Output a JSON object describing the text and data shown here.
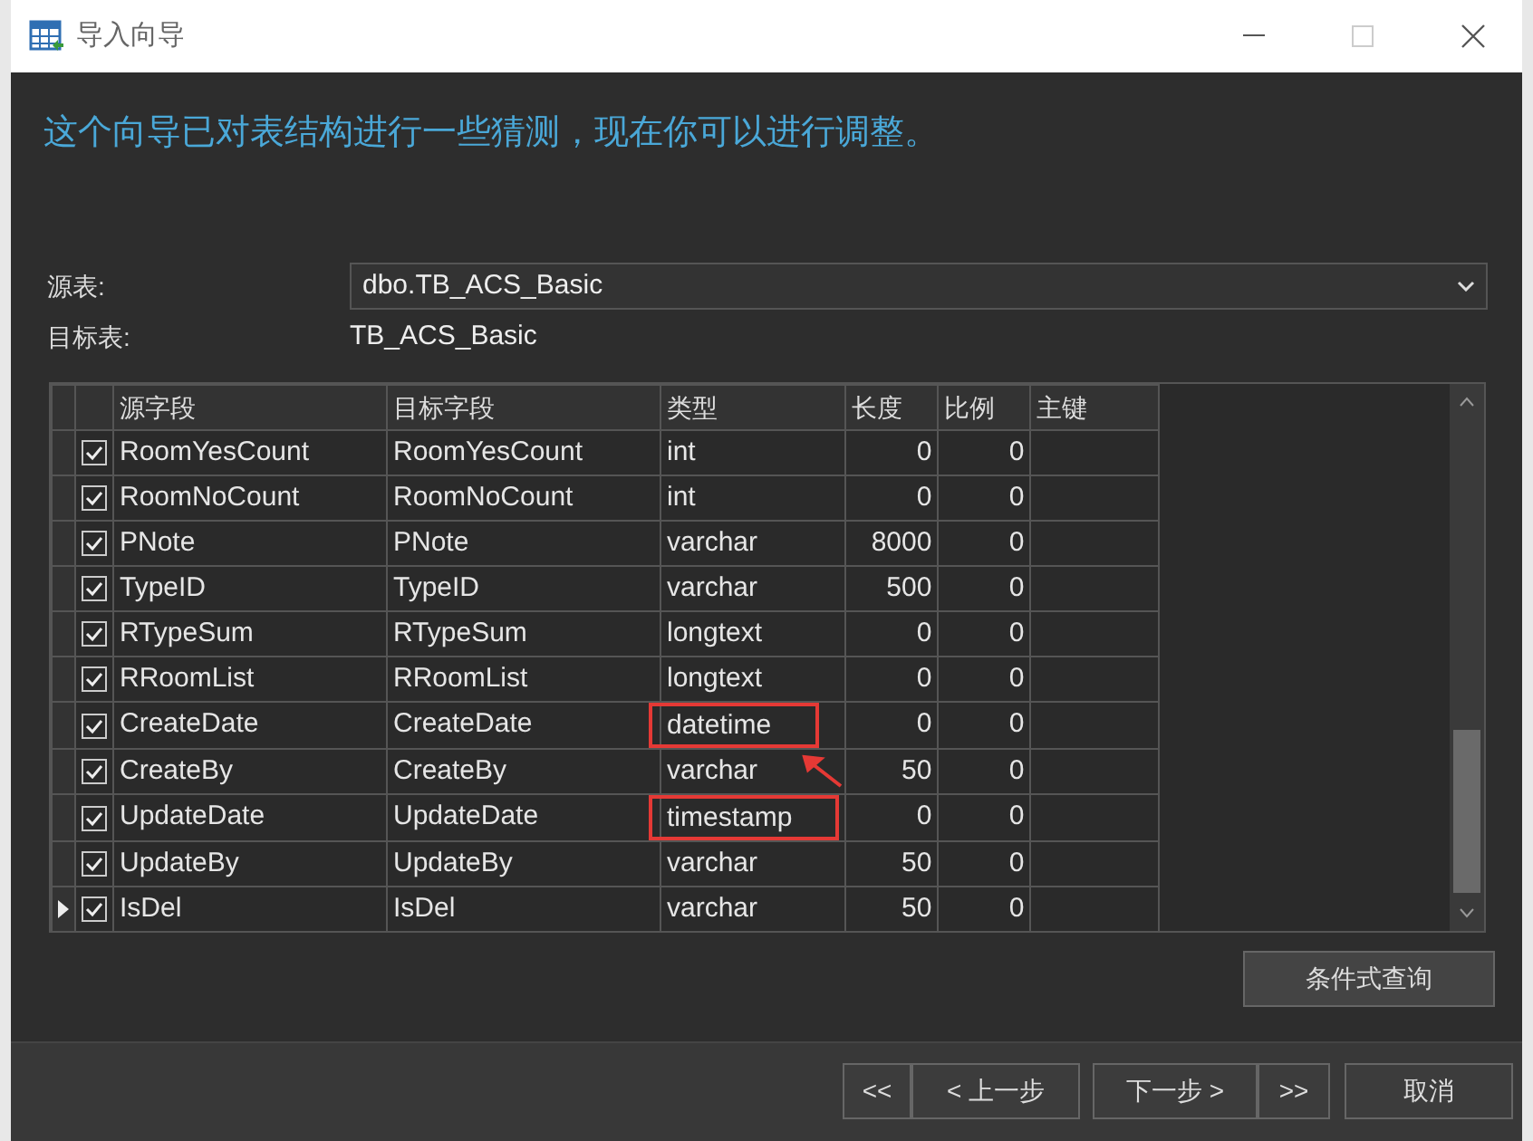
{
  "window": {
    "title": "导入向导"
  },
  "heading": "这个向导已对表结构进行一些猜测，现在你可以进行调整。",
  "source_table": {
    "label": "源表:",
    "value": "dbo.TB_ACS_Basic"
  },
  "target_table": {
    "label": "目标表:",
    "value": "TB_ACS_Basic"
  },
  "table": {
    "columns": [
      "源字段",
      "目标字段",
      "类型",
      "长度",
      "比例",
      "主键"
    ],
    "rows": [
      {
        "checked": true,
        "current": false,
        "highlighted": false,
        "source": "RoomYesCount",
        "target": "RoomYesCount",
        "type": "int",
        "length": "0",
        "scale": "0"
      },
      {
        "checked": true,
        "current": false,
        "highlighted": false,
        "source": "RoomNoCount",
        "target": "RoomNoCount",
        "type": "int",
        "length": "0",
        "scale": "0"
      },
      {
        "checked": true,
        "current": false,
        "highlighted": false,
        "source": "PNote",
        "target": "PNote",
        "type": "varchar",
        "length": "8000",
        "scale": "0"
      },
      {
        "checked": true,
        "current": false,
        "highlighted": false,
        "source": "TypeID",
        "target": "TypeID",
        "type": "varchar",
        "length": "500",
        "scale": "0"
      },
      {
        "checked": true,
        "current": false,
        "highlighted": false,
        "source": "RTypeSum",
        "target": "RTypeSum",
        "type": "longtext",
        "length": "0",
        "scale": "0"
      },
      {
        "checked": true,
        "current": false,
        "highlighted": false,
        "source": "RRoomList",
        "target": "RRoomList",
        "type": "longtext",
        "length": "0",
        "scale": "0"
      },
      {
        "checked": true,
        "current": false,
        "highlighted": true,
        "source": "CreateDate",
        "target": "CreateDate",
        "type": "datetime",
        "length": "0",
        "scale": "0"
      },
      {
        "checked": true,
        "current": false,
        "highlighted": false,
        "source": "CreateBy",
        "target": "CreateBy",
        "type": "varchar",
        "length": "50",
        "scale": "0"
      },
      {
        "checked": true,
        "current": false,
        "highlighted": true,
        "source": "UpdateDate",
        "target": "UpdateDate",
        "type": "timestamp",
        "length": "0",
        "scale": "0"
      },
      {
        "checked": true,
        "current": false,
        "highlighted": false,
        "source": "UpdateBy",
        "target": "UpdateBy",
        "type": "varchar",
        "length": "50",
        "scale": "0"
      },
      {
        "checked": true,
        "current": true,
        "highlighted": false,
        "source": "IsDel",
        "target": "IsDel",
        "type": "varchar",
        "length": "50",
        "scale": "0"
      }
    ]
  },
  "query_button": "条件式查询",
  "nav_buttons": [
    "<<",
    "< 上一步",
    "下一步 >",
    ">>"
  ],
  "cancel_button": "取消"
}
